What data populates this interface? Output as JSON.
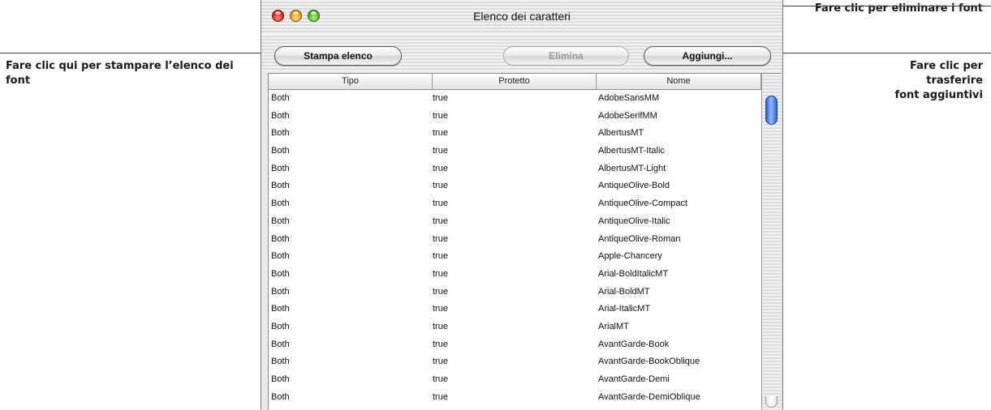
{
  "window": {
    "title": "Elenco dei caratteri"
  },
  "toolbar": {
    "print_label": "Stampa elenco",
    "delete_label": "Elimina",
    "add_label": "Aggiungi..."
  },
  "callouts": {
    "print": "Fare clic qui per stampare l’elenco dei font",
    "delete": "Fare clic per eliminare i font",
    "add_line1": "Fare clic per",
    "add_line2": "trasferire",
    "add_line3": "font aggiuntivi"
  },
  "table": {
    "columns": [
      "Tipo",
      "Protetto",
      "Nome"
    ],
    "rows": [
      [
        "Both",
        "true",
        "AdobeSansMM"
      ],
      [
        "Both",
        "true",
        "AdobeSerifMM"
      ],
      [
        "Both",
        "true",
        "AlbertusMT"
      ],
      [
        "Both",
        "true",
        "AlbertusMT-Italic"
      ],
      [
        "Both",
        "true",
        "AlbertusMT-Light"
      ],
      [
        "Both",
        "true",
        "AntiqueOlive-Bold"
      ],
      [
        "Both",
        "true",
        "AntiqueOlive-Compact"
      ],
      [
        "Both",
        "true",
        "AntiqueOlive-Italic"
      ],
      [
        "Both",
        "true",
        "AntiqueOlive-Roman"
      ],
      [
        "Both",
        "true",
        "Apple-Chancery"
      ],
      [
        "Both",
        "true",
        "Arial-BoldItalicMT"
      ],
      [
        "Both",
        "true",
        "Arial-BoldMT"
      ],
      [
        "Both",
        "true",
        "Arial-ItalicMT"
      ],
      [
        "Both",
        "true",
        "ArialMT"
      ],
      [
        "Both",
        "true",
        "AvantGarde-Book"
      ],
      [
        "Both",
        "true",
        "AvantGarde-BookOblique"
      ],
      [
        "Both",
        "true",
        "AvantGarde-Demi"
      ],
      [
        "Both",
        "true",
        "AvantGarde-DemiOblique"
      ]
    ]
  },
  "icons": {
    "close": "close-traffic-light-icon",
    "minimize": "minimize-traffic-light-icon",
    "zoom": "zoom-traffic-light-icon"
  },
  "colors": {
    "close": "#e0281c",
    "minimize": "#f0a015",
    "zoom": "#4cbc22",
    "scroll_thumb": "#2b5fd6"
  }
}
